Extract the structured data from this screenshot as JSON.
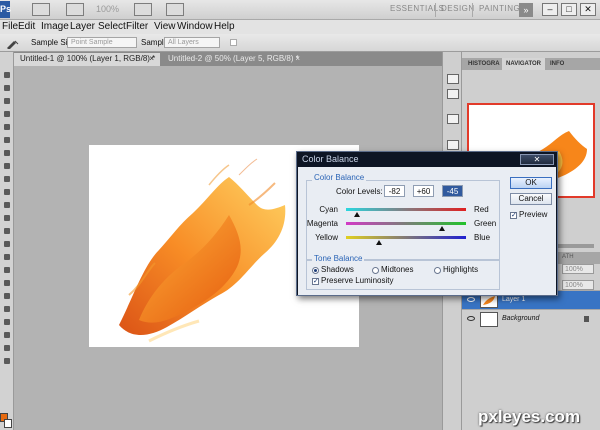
{
  "app": {
    "logo": "Ps",
    "zoom": "100%",
    "workspaces": [
      "ESSENTIALS",
      "DESIGN",
      "PAINTING"
    ],
    "more": "»",
    "window_controls": [
      "–",
      "□",
      "✕"
    ]
  },
  "menu": [
    "File",
    "Edit",
    "Image",
    "Layer",
    "Select",
    "Filter",
    "View",
    "Window",
    "Help"
  ],
  "options": {
    "sample_size_label": "Sample Size:",
    "sample_size_value": "Point Sample",
    "sample_label": "Sample:",
    "sample_value": "All Layers"
  },
  "tabs": [
    {
      "label": "Untitled-1 @ 100% (Layer 1, RGB/8) *",
      "close": "×"
    },
    {
      "label": "Untitled-2 @ 50% (Layer 5, RGB/8) *",
      "close": "×"
    }
  ],
  "navigator": {
    "tabs": [
      "HISTOGRA",
      "NAVIGATOR",
      "INFO"
    ]
  },
  "layers": {
    "header_text": "ATH",
    "opacity": "100%",
    "fill": "100%",
    "items": [
      {
        "name": "Layer 1",
        "selected": true
      },
      {
        "name": "Background",
        "selected": false,
        "locked": true
      }
    ]
  },
  "dialog": {
    "title": "Color Balance",
    "close_label": "✕",
    "color_balance_group": "Color Balance",
    "color_levels_label": "Color Levels:",
    "levels": [
      "-82",
      "+60",
      "-45"
    ],
    "sliders": [
      {
        "left": "Cyan",
        "right": "Red",
        "value": -82,
        "gradient": [
          "#2ad6df",
          "#e02020"
        ]
      },
      {
        "left": "Magenta",
        "right": "Green",
        "value": 60,
        "gradient": [
          "#d23ac6",
          "#22c22a"
        ]
      },
      {
        "left": "Yellow",
        "right": "Blue",
        "value": -45,
        "gradient": [
          "#e0d020",
          "#2020d0"
        ]
      }
    ],
    "tone_balance_group": "Tone Balance",
    "tones": [
      {
        "label": "Shadows",
        "selected": true
      },
      {
        "label": "Midtones",
        "selected": false
      },
      {
        "label": "Highlights",
        "selected": false
      }
    ],
    "preserve_luminosity_label": "Preserve Luminosity",
    "preserve_luminosity": true,
    "ok_label": "OK",
    "cancel_label": "Cancel",
    "preview_label": "Preview",
    "preview": true
  },
  "watermark": "pxleyes.com",
  "colors": {
    "foreground_swatch": "#e86b10",
    "background_swatch": "#ffffff",
    "selected_layer": "#3874c4",
    "dialog_frame": "#0d1524"
  }
}
